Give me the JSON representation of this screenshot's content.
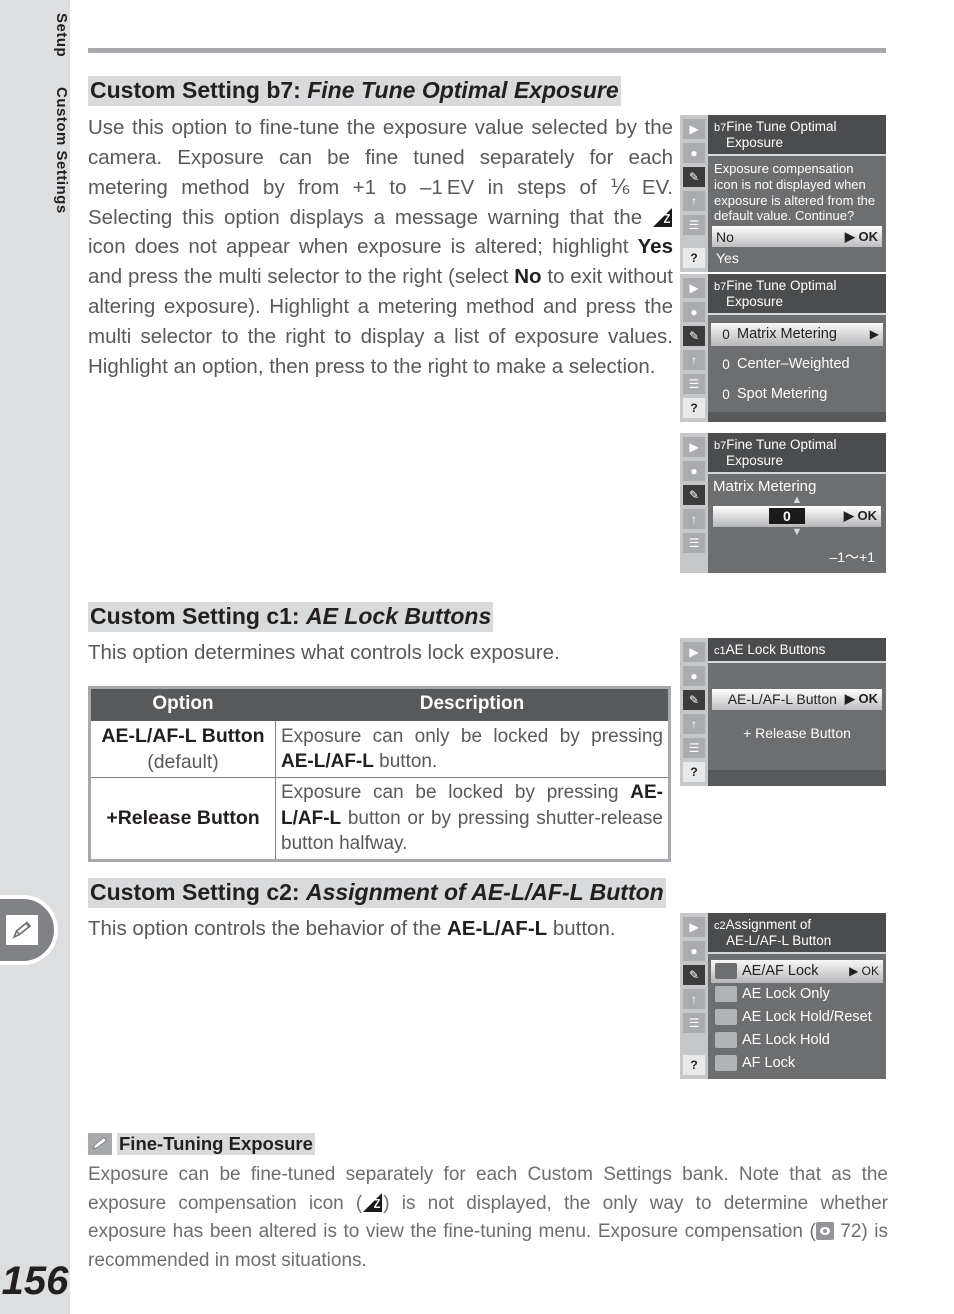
{
  "page": {
    "number": "156",
    "sidebar": {
      "upper_label": "Setup",
      "lower_label": "Custom Settings",
      "tab_icon": "pencil-icon"
    }
  },
  "sections": {
    "b7": {
      "title_prefix": "Custom Setting b7: ",
      "title_name": "Fine Tune Optimal Exposure",
      "body_1": "Use this option to fine-tune the exposure value selected by the camera.  Exposure can be fine tuned separately for each metering method by from +1 to –1 EV in steps of ⅙ EV.  Selecting this option displays a message warning that the ",
      "body_2": " icon does not appear when exposure is altered; highlight ",
      "bold_yes": "Yes",
      "body_3": " and press the multi selector to the right (select ",
      "bold_no": "No",
      "body_4": " to exit without altering exposure).  Highlight a metering method and press the multi selector to the right to display a list of exposure values.  Highlight an option, then press to the right to make a selection."
    },
    "c1": {
      "title_prefix": "Custom Setting c1: ",
      "title_name": "AE Lock Buttons",
      "body": "This option determines what controls lock exposure.",
      "table": {
        "headers": [
          "Option",
          "Description"
        ],
        "rows": [
          {
            "option": "AE-L/AF-L Button",
            "option_note": "(default)",
            "desc_1": "Exposure can only be locked by pressing ",
            "desc_bold": "AE-L/AF-L",
            "desc_2": " button."
          },
          {
            "option": "+Release Button",
            "option_note": "",
            "desc_1": "Exposure can be locked by pressing ",
            "desc_bold": "AE-L/AF-L",
            "desc_2": " button or by pressing shutter-release button halfway."
          }
        ]
      }
    },
    "c2": {
      "title_prefix": "Custom Setting c2: ",
      "title_name": "Assignment of AE-L/AF-L Button",
      "body_1": "This option controls the behavior of the ",
      "body_bold": "AE-L/AF-L",
      "body_2": " button."
    }
  },
  "screens": [
    {
      "id": "b7-warning",
      "rail": [
        "playback-icon",
        "shooting-menu-icon",
        "pencil-icon",
        "wrench-icon",
        "recent-settings-icon",
        "help-icon"
      ],
      "rail_selected_index": 2,
      "header_num": "b7",
      "header_line1": "Fine Tune Optimal",
      "header_line2": "Exposure",
      "message": "Exposure compensation icon is not displayed when exposure is altered from the default value. Continue?",
      "rows": [
        {
          "label": "No",
          "ok": "▶ OK",
          "highlighted": true
        },
        {
          "label": "Yes",
          "ok": "",
          "highlighted": false
        }
      ]
    },
    {
      "id": "b7-metering-list",
      "rail": [
        "playback-icon",
        "shooting-menu-icon",
        "pencil-icon",
        "wrench-icon",
        "recent-settings-icon",
        "help-icon"
      ],
      "rail_selected_index": 2,
      "header_num": "b7",
      "header_line1": "Fine Tune Optimal",
      "header_line2": "Exposure",
      "items": [
        {
          "value": "0",
          "label": "Matrix Metering",
          "arrow": "▶",
          "highlighted": true
        },
        {
          "value": "0",
          "label": "Center–Weighted",
          "arrow": "",
          "highlighted": false
        },
        {
          "value": "0",
          "label": "Spot Metering",
          "arrow": "",
          "highlighted": false
        }
      ]
    },
    {
      "id": "b7-value-stepper",
      "rail": [
        "playback-icon",
        "shooting-menu-icon",
        "pencil-icon",
        "wrench-icon",
        "recent-settings-icon"
      ],
      "rail_selected_index": 2,
      "header_num": "b7",
      "header_line1": "Fine Tune Optimal",
      "header_line2": "Exposure",
      "mode_label": "Matrix Metering",
      "up_arrow": "▲",
      "value": "0",
      "ok": "▶ OK",
      "down_arrow": "▼",
      "range": "–1〜+1"
    },
    {
      "id": "c1-ae-lock-buttons",
      "rail": [
        "playback-icon",
        "shooting-menu-icon",
        "pencil-icon",
        "wrench-icon",
        "recent-settings-icon",
        "help-icon"
      ],
      "rail_selected_index": 2,
      "header_num": "c1",
      "header_line1": "AE Lock Buttons",
      "header_line2": "",
      "rows": [
        {
          "label": "AE-L/AF-L Button",
          "ok": "▶ OK",
          "highlighted": true
        },
        {
          "label": "+ Release Button",
          "ok": "",
          "highlighted": false
        }
      ]
    },
    {
      "id": "c2-assignment",
      "rail": [
        "playback-icon",
        "shooting-menu-icon",
        "pencil-icon",
        "wrench-icon",
        "recent-settings-icon",
        "help-icon"
      ],
      "rail_selected_index": 2,
      "header_num": "c2",
      "header_line1": "Assignment of",
      "header_line2": "AE-L/AF-L Button",
      "items": [
        {
          "glyph": "ae-af-lock-icon",
          "label": "AE/AF Lock",
          "arrow": "▶ OK",
          "highlighted": true
        },
        {
          "glyph": "ae-lock-icon",
          "label": "AE Lock Only",
          "arrow": "",
          "highlighted": false
        },
        {
          "glyph": "ae-lock-hold-reset-icon",
          "label": "AE Lock Hold/Reset",
          "arrow": "",
          "highlighted": false
        },
        {
          "glyph": "ae-lock-hold-icon",
          "label": "AE Lock Hold",
          "arrow": "",
          "highlighted": false
        },
        {
          "glyph": "af-lock-icon",
          "label": "AF Lock",
          "arrow": "",
          "highlighted": false
        }
      ]
    }
  ],
  "tip": {
    "icon": "pencil-icon",
    "title": "Fine-Tuning Exposure",
    "body_1": "Exposure can be fine-tuned separately for each Custom Settings bank.  Note that as the exposure compensation icon (",
    "body_2": ") is not displayed, the only way to determine whether exposure has been altered is to view the fine-tuning menu.  Exposure compensation (",
    "body_3": " 72) is recommended in most situations."
  },
  "colors": {
    "sidebar_bg": "#dcdee0",
    "heading_highlight": "#d9dadb",
    "rule": "#a7a9ac",
    "table_header_bg": "#58595b",
    "screen_bg": "#6d6e70",
    "screen_header_bg": "#4b4c4e",
    "text": "#58595b",
    "text_dark": "#231f20"
  }
}
